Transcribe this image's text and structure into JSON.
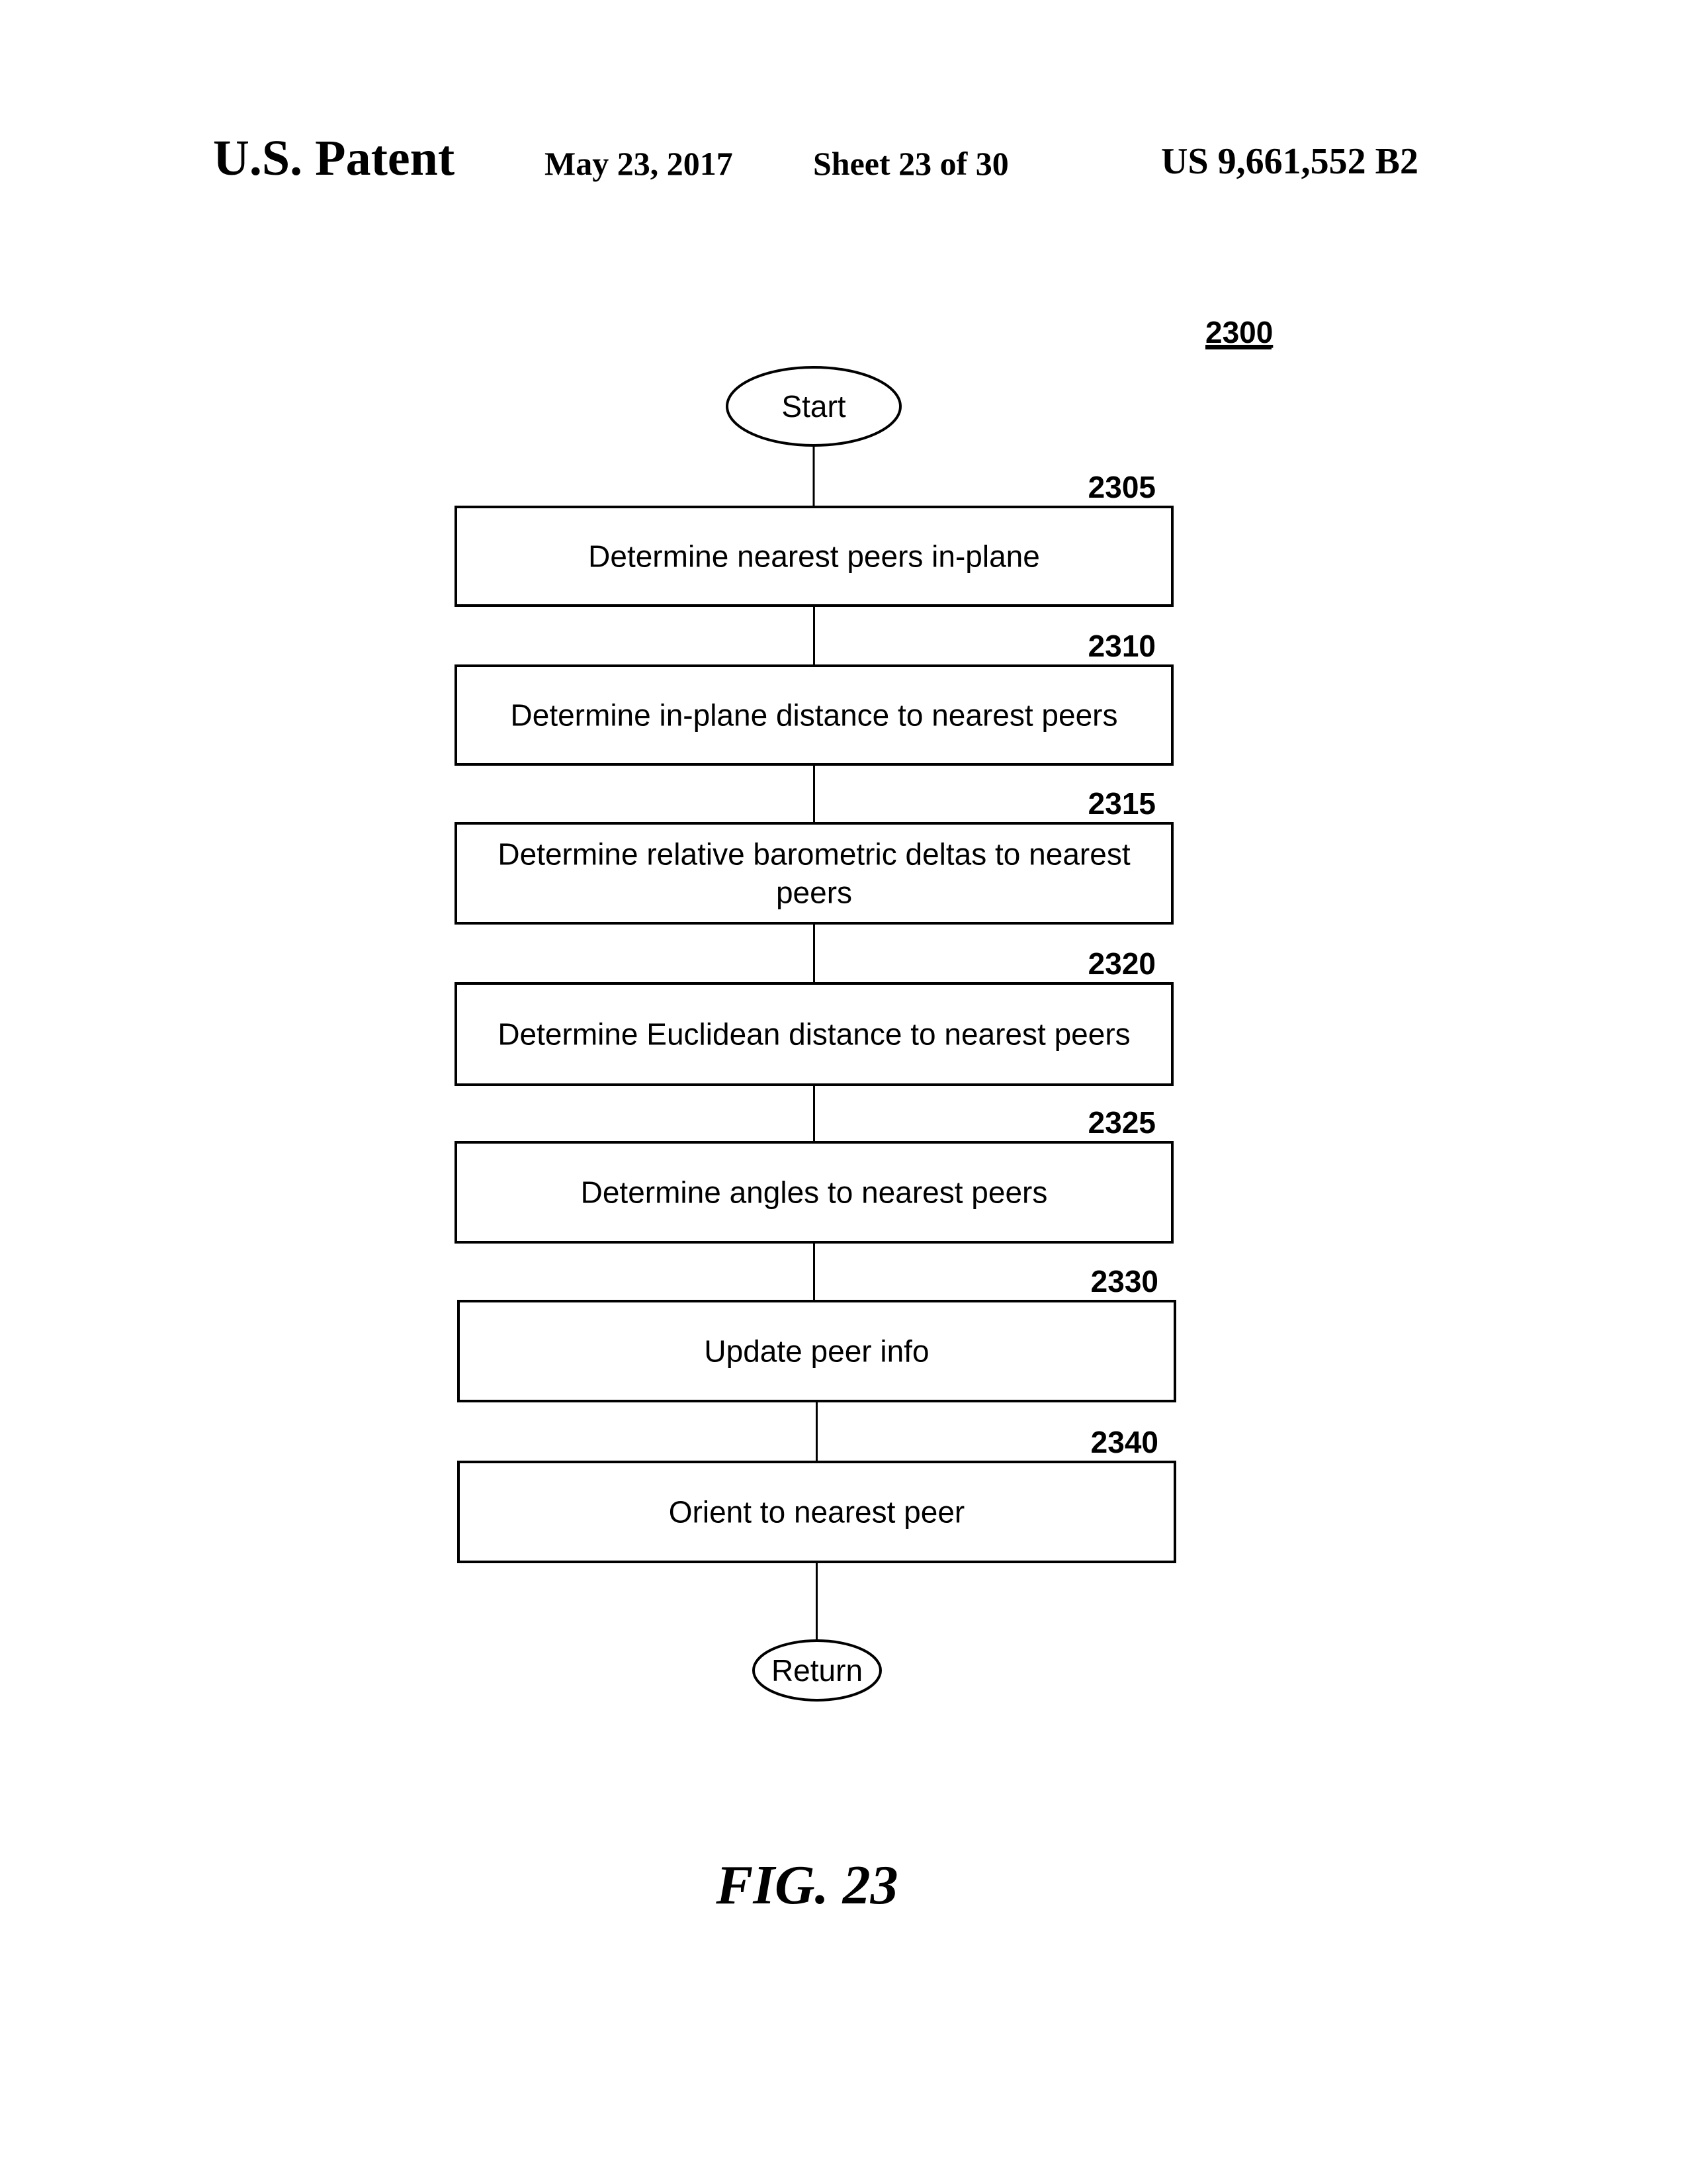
{
  "header": {
    "title": "U.S. Patent",
    "date": "May 23, 2017",
    "sheet": "Sheet 23 of 30",
    "patent_number": "US 9,661,552 B2"
  },
  "figure": {
    "ref": "2300",
    "caption": "FIG. 23",
    "start_label": "Start",
    "end_label": "Return",
    "steps": [
      {
        "ref": "2305",
        "lines": [
          "Determine nearest peers in-plane"
        ]
      },
      {
        "ref": "2310",
        "lines": [
          "Determine in-plane distance to nearest peers"
        ]
      },
      {
        "ref": "2315",
        "lines": [
          "Determine relative barometric deltas to nearest",
          "peers"
        ]
      },
      {
        "ref": "2320",
        "lines": [
          "Determine Euclidean distance to nearest peers"
        ]
      },
      {
        "ref": "2325",
        "lines": [
          "Determine angles to nearest peers"
        ]
      },
      {
        "ref": "2330",
        "lines": [
          "Update peer info"
        ]
      },
      {
        "ref": "2340",
        "lines": [
          "Orient to nearest peer"
        ]
      }
    ]
  }
}
